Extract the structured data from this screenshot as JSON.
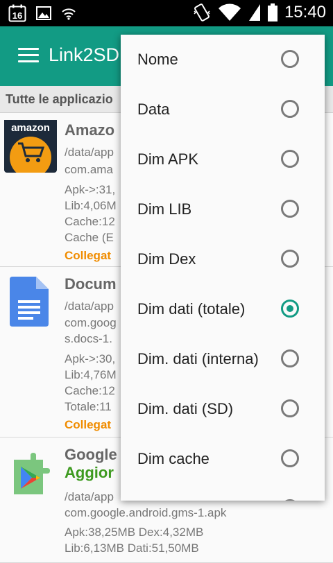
{
  "status_bar": {
    "time": "15:40",
    "calendar_day": "16",
    "icons": [
      "calendar-icon",
      "image-icon",
      "wifi-icon",
      "vibrate-icon",
      "wifi-signal-icon",
      "cell-signal-icon",
      "battery-icon"
    ]
  },
  "app_bar": {
    "title": "Link2SD"
  },
  "filter": {
    "label": "Tutte le applicazio"
  },
  "apps": [
    {
      "name": "Amazo",
      "lines": [
        "/data/app",
        "com.ama",
        "Apk->:31,",
        "Lib:4,06M",
        "Cache:12",
        "Cache (E"
      ],
      "linked": "Collegat",
      "icon": "amazon-icon",
      "icon_label": "amazon"
    },
    {
      "name": "Docum",
      "lines": [
        "/data/app",
        "com.goog",
        "s.docs-1.",
        "Apk->:30,",
        "Lib:4,76M",
        "Cache:12",
        "Totale:11"
      ],
      "linked": "Collegat",
      "icon": "docs-icon"
    },
    {
      "name": "Google",
      "update": "Aggior",
      "lines": [
        "/data/app",
        "com.google.android.gms-1.apk",
        "Apk:38,25MB  Dex:4,32MB",
        "Lib:6,13MB  Dati:51,50MB"
      ],
      "icon": "play-services-icon"
    }
  ],
  "sort_menu": {
    "items": [
      {
        "label": "Nome",
        "checked": false
      },
      {
        "label": "Data",
        "checked": false
      },
      {
        "label": "Dim APK",
        "checked": false
      },
      {
        "label": "Dim LIB",
        "checked": false
      },
      {
        "label": "Dim Dex",
        "checked": false
      },
      {
        "label": "Dim dati (totale)",
        "checked": true
      },
      {
        "label": "Dim. dati (interna)",
        "checked": false
      },
      {
        "label": "Dim. dati (SD)",
        "checked": false
      },
      {
        "label": "Dim cache",
        "checked": false
      }
    ],
    "accent_color": "#129b84"
  },
  "colors": {
    "app_bar": "#129b84",
    "linked_text": "#f08c00",
    "update_text": "#3d9a1f"
  }
}
